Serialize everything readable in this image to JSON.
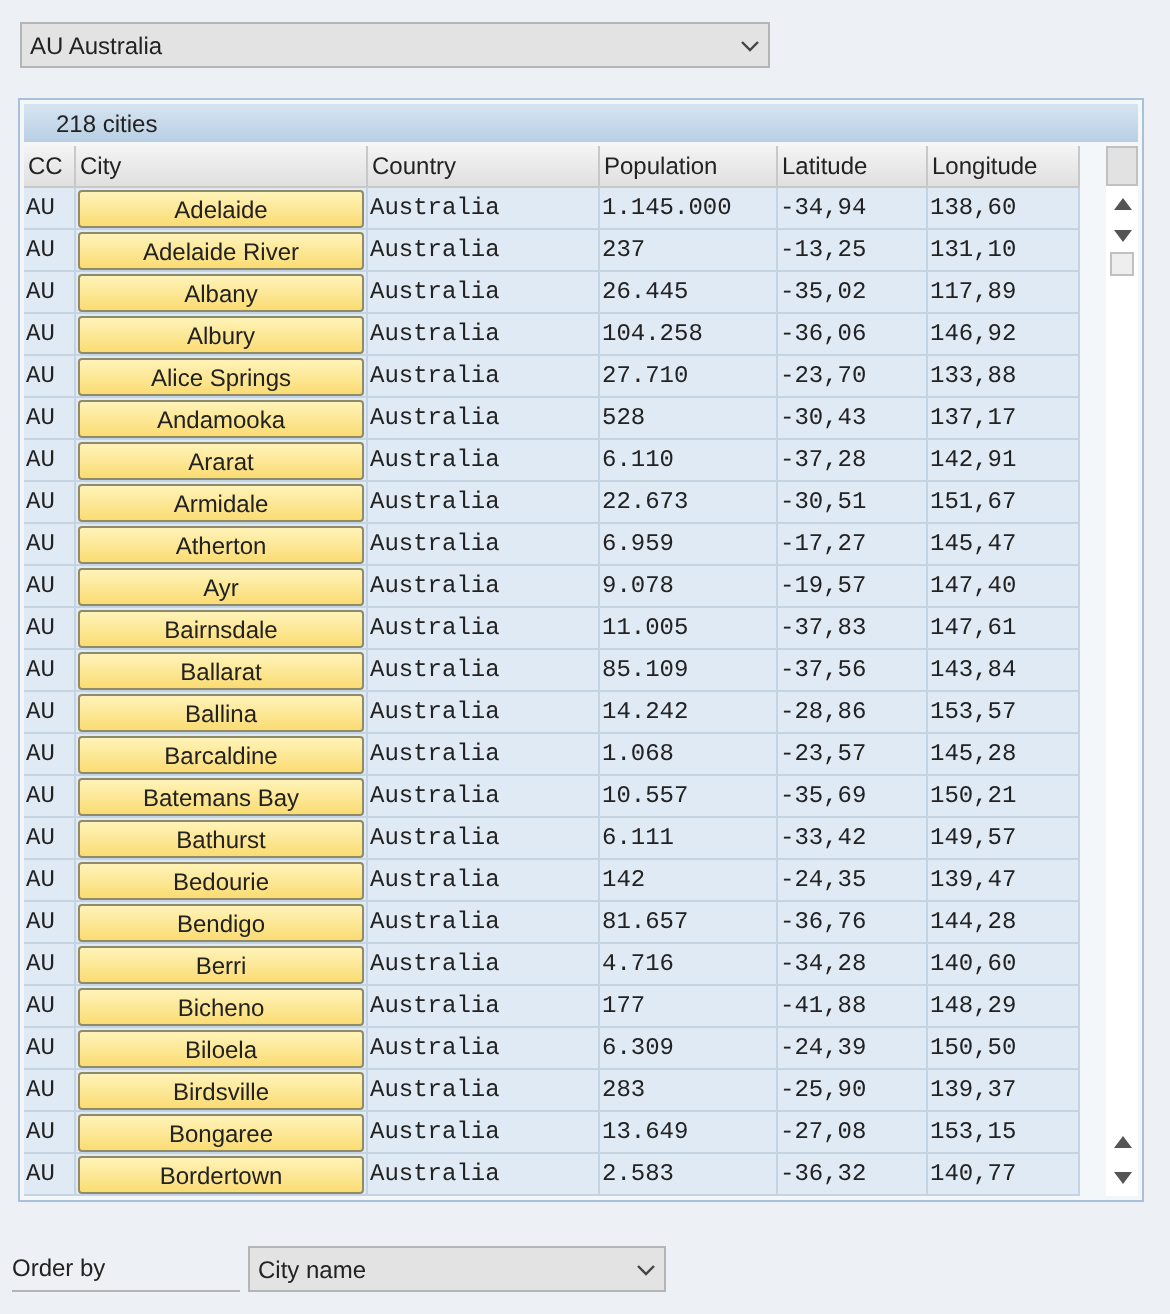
{
  "country_select": {
    "value": "AU Australia"
  },
  "table": {
    "title": "218 cities",
    "columns": [
      "CC",
      "City",
      "Country",
      "Population",
      "Latitude",
      "Longitude"
    ],
    "rows": [
      {
        "cc": "AU",
        "city": "Adelaide",
        "country": "Australia",
        "population": "1.145.000",
        "latitude": "-34,94",
        "longitude": "138,60"
      },
      {
        "cc": "AU",
        "city": "Adelaide River",
        "country": "Australia",
        "population": "237",
        "latitude": "-13,25",
        "longitude": "131,10"
      },
      {
        "cc": "AU",
        "city": "Albany",
        "country": "Australia",
        "population": "26.445",
        "latitude": "-35,02",
        "longitude": "117,89"
      },
      {
        "cc": "AU",
        "city": "Albury",
        "country": "Australia",
        "population": "104.258",
        "latitude": "-36,06",
        "longitude": "146,92"
      },
      {
        "cc": "AU",
        "city": "Alice Springs",
        "country": "Australia",
        "population": "27.710",
        "latitude": "-23,70",
        "longitude": "133,88"
      },
      {
        "cc": "AU",
        "city": "Andamooka",
        "country": "Australia",
        "population": "528",
        "latitude": "-30,43",
        "longitude": "137,17"
      },
      {
        "cc": "AU",
        "city": "Ararat",
        "country": "Australia",
        "population": "6.110",
        "latitude": "-37,28",
        "longitude": "142,91"
      },
      {
        "cc": "AU",
        "city": "Armidale",
        "country": "Australia",
        "population": "22.673",
        "latitude": "-30,51",
        "longitude": "151,67"
      },
      {
        "cc": "AU",
        "city": "Atherton",
        "country": "Australia",
        "population": "6.959",
        "latitude": "-17,27",
        "longitude": "145,47"
      },
      {
        "cc": "AU",
        "city": "Ayr",
        "country": "Australia",
        "population": "9.078",
        "latitude": "-19,57",
        "longitude": "147,40"
      },
      {
        "cc": "AU",
        "city": "Bairnsdale",
        "country": "Australia",
        "population": "11.005",
        "latitude": "-37,83",
        "longitude": "147,61"
      },
      {
        "cc": "AU",
        "city": "Ballarat",
        "country": "Australia",
        "population": "85.109",
        "latitude": "-37,56",
        "longitude": "143,84"
      },
      {
        "cc": "AU",
        "city": "Ballina",
        "country": "Australia",
        "population": "14.242",
        "latitude": "-28,86",
        "longitude": "153,57"
      },
      {
        "cc": "AU",
        "city": "Barcaldine",
        "country": "Australia",
        "population": "1.068",
        "latitude": "-23,57",
        "longitude": "145,28"
      },
      {
        "cc": "AU",
        "city": "Batemans Bay",
        "country": "Australia",
        "population": "10.557",
        "latitude": "-35,69",
        "longitude": "150,21"
      },
      {
        "cc": "AU",
        "city": "Bathurst",
        "country": "Australia",
        "population": "6.111",
        "latitude": "-33,42",
        "longitude": "149,57"
      },
      {
        "cc": "AU",
        "city": "Bedourie",
        "country": "Australia",
        "population": "142",
        "latitude": "-24,35",
        "longitude": "139,47"
      },
      {
        "cc": "AU",
        "city": "Bendigo",
        "country": "Australia",
        "population": "81.657",
        "latitude": "-36,76",
        "longitude": "144,28"
      },
      {
        "cc": "AU",
        "city": "Berri",
        "country": "Australia",
        "population": "4.716",
        "latitude": "-34,28",
        "longitude": "140,60"
      },
      {
        "cc": "AU",
        "city": "Bicheno",
        "country": "Australia",
        "population": "177",
        "latitude": "-41,88",
        "longitude": "148,29"
      },
      {
        "cc": "AU",
        "city": "Biloela",
        "country": "Australia",
        "population": "6.309",
        "latitude": "-24,39",
        "longitude": "150,50"
      },
      {
        "cc": "AU",
        "city": "Birdsville",
        "country": "Australia",
        "population": "283",
        "latitude": "-25,90",
        "longitude": "139,37"
      },
      {
        "cc": "AU",
        "city": "Bongaree",
        "country": "Australia",
        "population": "13.649",
        "latitude": "-27,08",
        "longitude": "153,15"
      },
      {
        "cc": "AU",
        "city": "Bordertown",
        "country": "Australia",
        "population": "2.583",
        "latitude": "-36,32",
        "longitude": "140,77"
      }
    ]
  },
  "order_by": {
    "label": "Order by",
    "value": "City name"
  }
}
